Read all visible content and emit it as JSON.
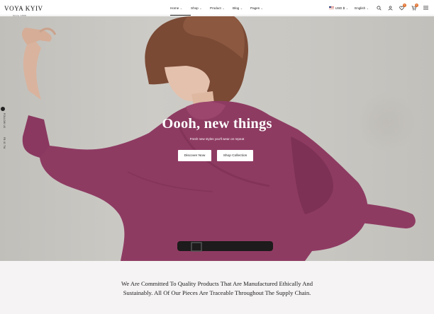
{
  "brand": {
    "logo_text": "VOYA KYIV",
    "logo_sub": "Since 1888"
  },
  "nav": {
    "items": [
      {
        "label": "Home"
      },
      {
        "label": "Shop"
      },
      {
        "label": "Product"
      },
      {
        "label": "Blog"
      },
      {
        "label": "Pages"
      }
    ],
    "active_index": 0
  },
  "tools": {
    "currency": "USD $",
    "language": "English",
    "wishlist_count": "0",
    "cart_count": "0"
  },
  "hero": {
    "title": "Oooh, new things",
    "subtitle": "Fresh new styles you'll wear on repeat",
    "primary_button": "Discover Now",
    "secondary_button": "Shop Collection"
  },
  "side_social": {
    "label_top": "FOLLOW US",
    "label_bottom": "FB IG TW"
  },
  "mission": {
    "text": "We Are Committed To Quality Products That Are Manufactured Ethically And Sustainably. All Of Our Pieces Are Traceable Throughout The Supply Chain."
  },
  "colors": {
    "accent": "#e2702c",
    "blouse": "#8e3b62",
    "background": "#c8c6c1",
    "mission_bg": "#f5f3f3"
  },
  "icons": [
    "chevron-down-icon",
    "flag-us-icon",
    "search-icon",
    "user-icon",
    "heart-icon",
    "cart-icon",
    "menu-icon"
  ]
}
